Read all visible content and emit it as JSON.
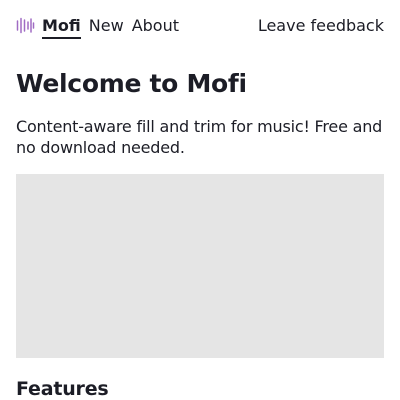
{
  "nav": {
    "logo_icon": "waveform-icon",
    "brand_color": "#a06cc4",
    "brand": "Mofi",
    "links": [
      "New",
      "About"
    ],
    "feedback": "Leave feedback"
  },
  "main": {
    "title": "Welcome to Mofi",
    "description": "Content-aware fill and trim for music! Free and no download needed.",
    "features_heading": "Features"
  }
}
